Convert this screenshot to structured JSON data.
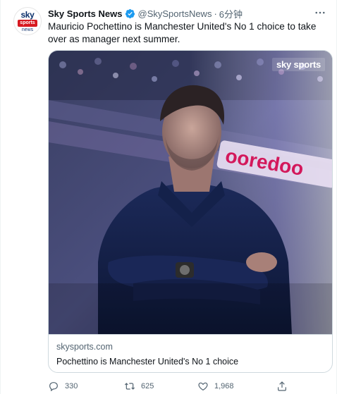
{
  "tweet": {
    "avatar": {
      "line1": "sky",
      "line2": "sports",
      "line3": "news"
    },
    "display_name": "Sky Sports News",
    "verified_icon": "verified-badge-icon",
    "handle": "@SkySportsNews",
    "separator": "·",
    "time": "6分钟",
    "more_icon": "more-icon",
    "text": "Mauricio Pochettino is Manchester United's No 1 choice to take over as manager next summer."
  },
  "card": {
    "watermark": "sky sports",
    "banner_text": "ooredoo",
    "domain": "skysports.com",
    "title": "Pochettino is Manchester United's No 1 choice"
  },
  "actions": {
    "reply": {
      "icon": "reply-icon",
      "count": "330"
    },
    "retweet": {
      "icon": "retweet-icon",
      "count": "625"
    },
    "like": {
      "icon": "heart-icon",
      "count": "1,968"
    },
    "share": {
      "icon": "share-icon"
    }
  },
  "colors": {
    "accent": "#1d9bf0",
    "text_secondary": "#536471",
    "sky_red": "#d71920"
  }
}
